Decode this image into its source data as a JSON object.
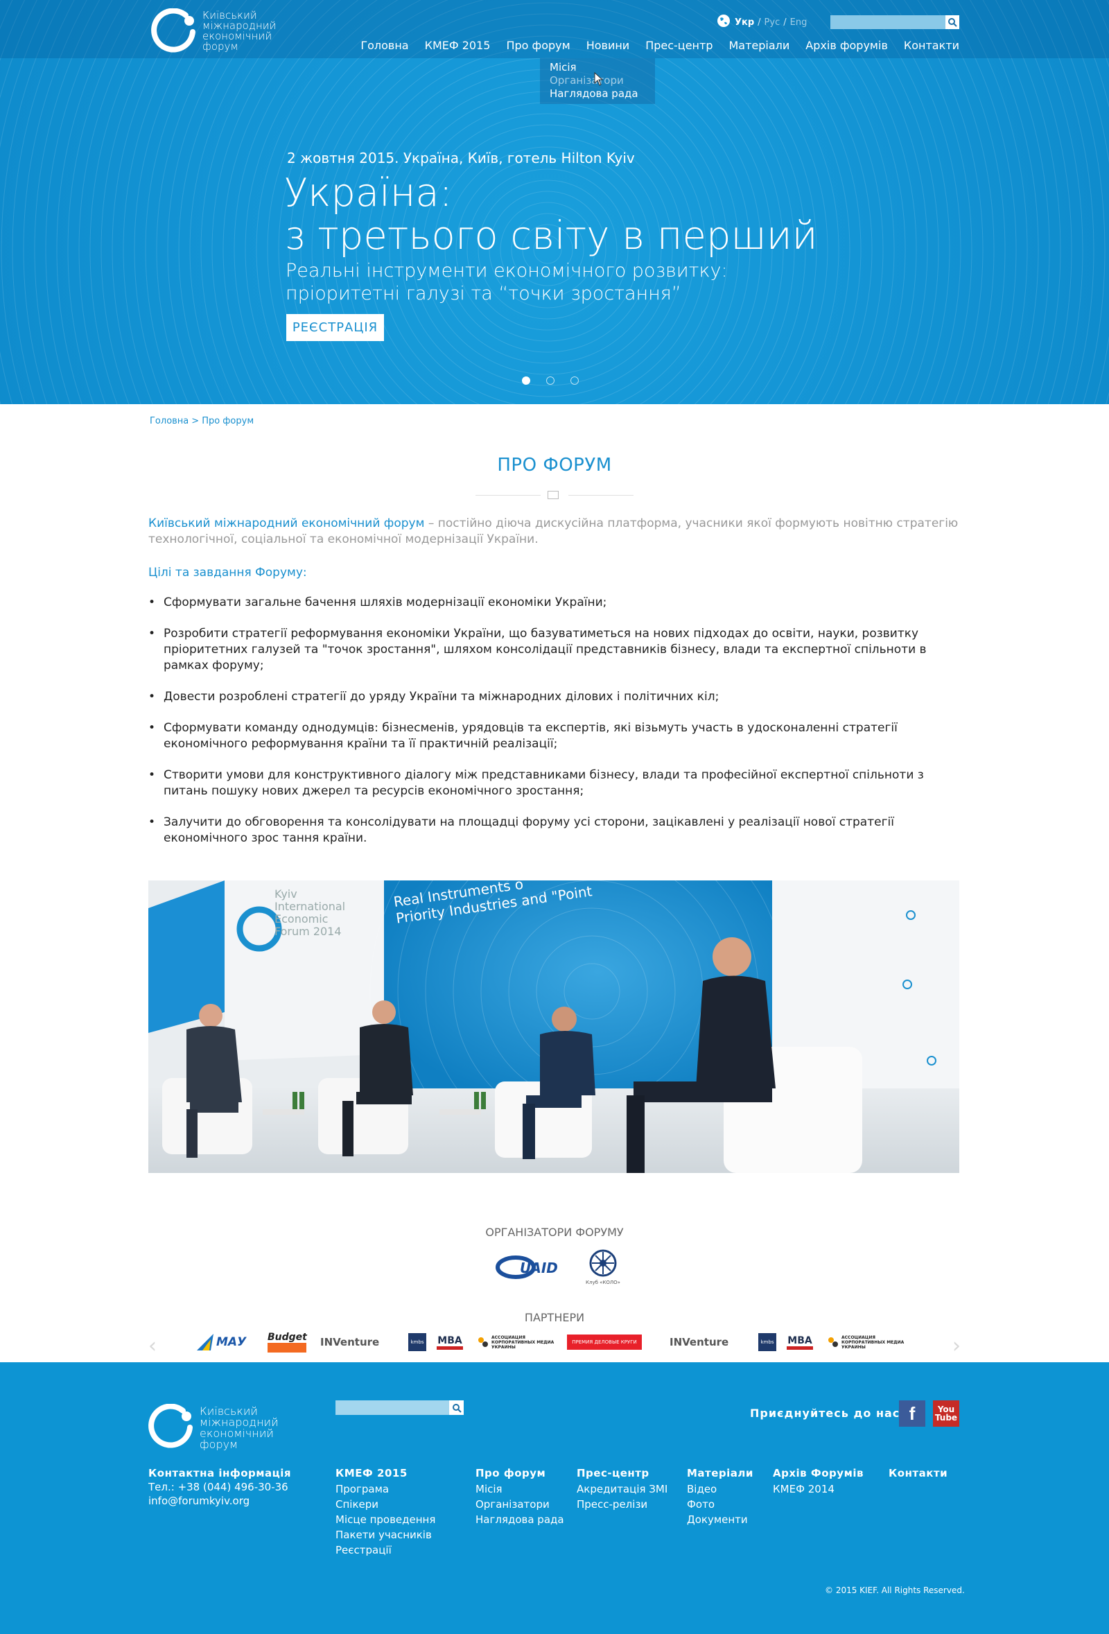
{
  "header": {
    "logo_lines": [
      "Київський",
      "міжнародний",
      "економічний",
      "форум"
    ],
    "languages": [
      {
        "label": "Укр",
        "active": true
      },
      {
        "label": "Рус",
        "active": false
      },
      {
        "label": "Eng",
        "active": false
      }
    ],
    "search_placeholder": "",
    "nav": [
      "Головна",
      "КМЕФ 2015",
      "Про форум",
      "Новини",
      "Прес-центр",
      "Матеріали",
      "Архів форумів",
      "Контакти"
    ],
    "dropdown": [
      "Місія",
      "Організатори",
      "Наглядова рада"
    ]
  },
  "hero": {
    "date": "2 жовтня 2015. Україна, Київ, готель Hilton Kyiv",
    "title_line1": "Україна:",
    "title_line2": "з третього світу в перший",
    "subtitle_line1": "Реальні інструменти економічного розвитку:",
    "subtitle_line2": "пріоритетні галузі та “точки зростання”",
    "register_label": "РЕЄСТРАЦІЯ",
    "slides": 3,
    "active_slide": 1
  },
  "breadcrumb": {
    "home": "Головна",
    "separator": ">",
    "current": "Про форум"
  },
  "main": {
    "title": "ПРО ФОРУМ",
    "intro_highlight": "Київський міжнародний економічний форум",
    "intro_rest": " – постійно діюча дискусійна платформа, учасники якої формують новітню стратегію технологічної, соціальної та економічної модернізації України.",
    "goals_heading": "Цілі та завдання Форуму:",
    "goals": [
      "Сформувати загальне бачення шляхів модернізації економіки України;",
      "Розробити стратегії реформування економіки України, що базуватиметься на нових підходах до освіти, науки, розвитку пріоритетних галузей та \"точок зростання\", шляхом консолідації представників бізнесу, влади та експертної спільноти в рамках форуму;",
      "Довести розроблені стратегії до уряду України та міжнародних ділових і політичних кіл;",
      "Сформувати команду однодумців: бізнесменів, урядовців та експертів, які візьмуть участь в удосконаленні стратегії економічного реформування країни та її практичній реалізації;",
      "Створити умови для конструктивного діалогу між представниками бізнесу, влади та професійної експертної спільноти з питань пошуку нових джерел та ресурсів економічного зростання;",
      "Залучити до обговорення та консолідувати на площадці форуму усі сторони, зацікавлені у реалізації нової стратегії економічного зрос тання країни."
    ],
    "photo_backdrop_text": [
      "Kyiv",
      "International",
      "Economic",
      "Forum 2014"
    ],
    "photo_banner_text": [
      "Real Instruments o",
      "Priority Industries and \"Point"
    ]
  },
  "organizers": {
    "title": "ОРГАНІЗАТОРИ ФОРУМУ",
    "logos": [
      "UAID",
      "Клуб «КОЛО»"
    ]
  },
  "partners": {
    "title": "ПАРТНЕРИ",
    "logos": [
      "МАУ",
      "Budget",
      "INVenture",
      "kmbs",
      "MBA",
      "АССОЦИАЦИЯ КОРПОРАТИВНЫХ МЕДИА УКРАИНЫ",
      "ПРЕМИЯ ДЕЛОВЫЕ КРУГИ",
      "INVenture",
      "kmbs",
      "MBA",
      "АССОЦИАЦИЯ КОРПОРАТИВНЫХ МЕДИА УКРАИНЫ"
    ]
  },
  "footer": {
    "logo_lines": [
      "Київський",
      "міжнародний",
      "економічний",
      "форум"
    ],
    "join_label": "Приєднуйтесь до нас:",
    "social": [
      "f",
      "You Tube"
    ],
    "contact_heading": "Контактна інформація",
    "phone": "Тел.: +38 (044) 496-30-36",
    "email": "info@forumkyiv.org",
    "columns": [
      {
        "heading": "КМЕФ 2015",
        "links": [
          "Програма",
          "Спікери",
          "Місце проведення",
          "Пакети учасників",
          "Реєстрації"
        ]
      },
      {
        "heading": "Про форум",
        "links": [
          "Місія",
          "Організатори",
          "Наглядова рада"
        ]
      },
      {
        "heading": "Прес-центр",
        "links": [
          "Акредитація ЗМІ",
          "Пресс-релізи"
        ]
      },
      {
        "heading": "Матеріали",
        "links": [
          "Відео",
          "Фото",
          "Документи"
        ]
      },
      {
        "heading": "Архів Форумів",
        "links": [
          "КМЕФ 2014"
        ]
      },
      {
        "heading": "Контакти",
        "links": []
      }
    ],
    "copyright": "© 2015 KIEF. All Rights Reserved."
  },
  "colors": {
    "brand_blue": "#1a90cf",
    "hero_blue": "#1596d6",
    "footer_blue": "#0d94d3"
  }
}
